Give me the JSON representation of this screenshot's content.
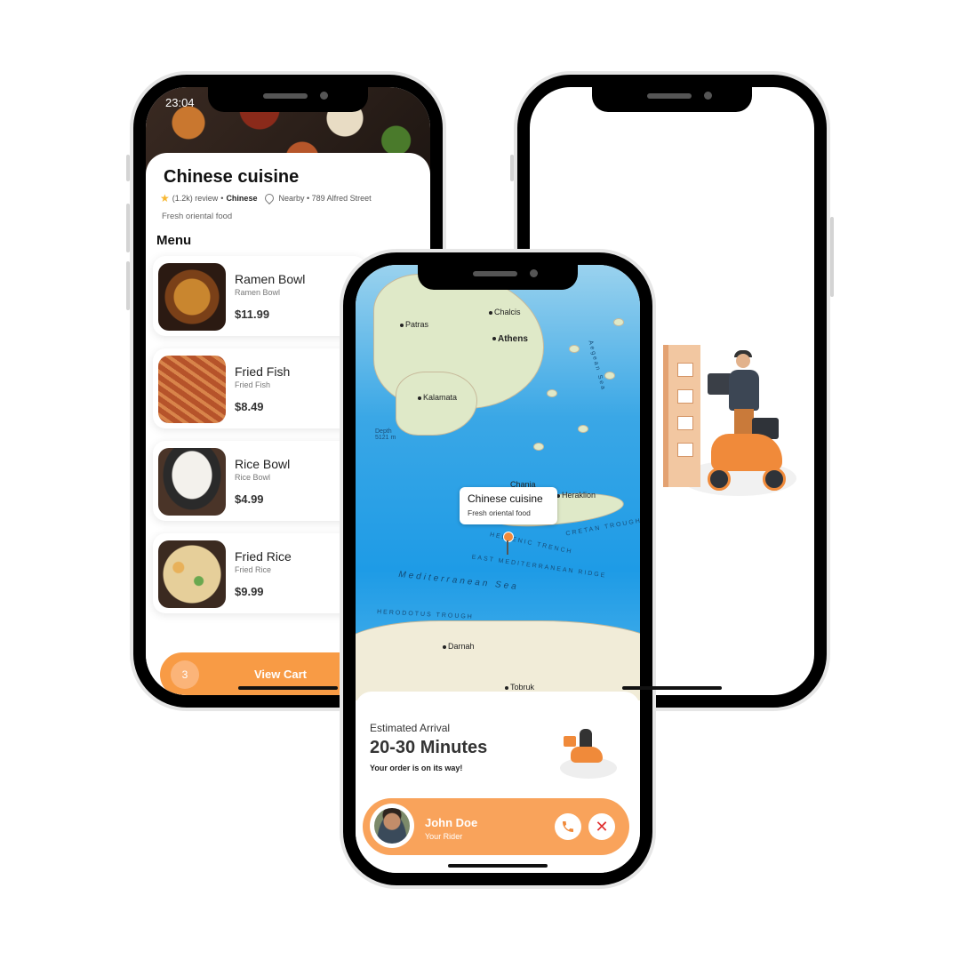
{
  "left_screen": {
    "status_time": "23:04",
    "restaurant": {
      "title": "Chinese cuisine",
      "reviews": "(1.2k) review",
      "category": "Chinese",
      "location": "Nearby • 789 Alfred Street",
      "description": "Fresh oriental food"
    },
    "menu_heading": "Menu",
    "menu_items": [
      {
        "name": "Ramen Bowl",
        "subtitle": "Ramen Bowl",
        "price": "$11.99"
      },
      {
        "name": "Fried Fish",
        "subtitle": "Fried Fish",
        "price": "$8.49"
      },
      {
        "name": "Rice Bowl",
        "subtitle": "Rice Bowl",
        "price": "$4.99"
      },
      {
        "name": "Fried Rice",
        "subtitle": "Fried Rice",
        "price": "$9.99"
      }
    ],
    "cart": {
      "count": "3",
      "label": "View Cart"
    }
  },
  "center_screen": {
    "map": {
      "places": [
        "Patras",
        "Chalcis",
        "Athens",
        "Kalamata",
        "Chania",
        "Heraklion",
        "Darnah",
        "Tobruk"
      ],
      "depth_label": "Depth\n5121 m",
      "sea_labels": [
        "Mediterranean Sea",
        "Aegean Sea",
        "HERODOTUS TROUGH",
        "EAST MEDITERRANEAN RIDGE",
        "CRETAN TROUGH",
        "HELLENIC TRENCH"
      ],
      "callout": {
        "title": "Chinese cuisine",
        "subtitle": "Fresh oriental food"
      }
    },
    "arrival": {
      "label": "Estimated Arrival",
      "time": "20-30 Minutes",
      "status": "Your order is on its way!"
    },
    "rider": {
      "name": "John Doe",
      "role": "Your Rider"
    }
  },
  "colors": {
    "accent": "#f89b45",
    "accent_light": "#f9a35b",
    "close_red": "#e03131"
  }
}
